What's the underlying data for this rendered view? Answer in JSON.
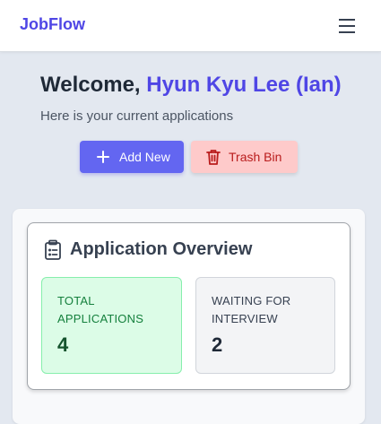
{
  "navbar": {
    "brand": "JobFlow",
    "menu_icon": "hamburger-menu-icon"
  },
  "welcome": {
    "prefix": "Welcome, ",
    "user_name": "Hyun Kyu Lee (Ian)",
    "subtitle": "Here is your current applications"
  },
  "actions": {
    "add_label": "Add New",
    "add_icon": "plus-icon",
    "trash_label": "Trash Bin",
    "trash_icon": "trash-icon"
  },
  "overview": {
    "title": "Application Overview",
    "icon": "clipboard-list-icon",
    "stats": [
      {
        "label": "Total Applications",
        "value": "4"
      },
      {
        "label": "Waiting for Interview",
        "value": "2"
      }
    ]
  },
  "colors": {
    "brand": "#4f46e5",
    "add_button": "#6366f1",
    "trash_button_bg": "#fecaca",
    "trash_button_text": "#b91c1c",
    "total_card_bg": "#dcfce7",
    "waiting_card_bg": "#f3f4f6"
  }
}
